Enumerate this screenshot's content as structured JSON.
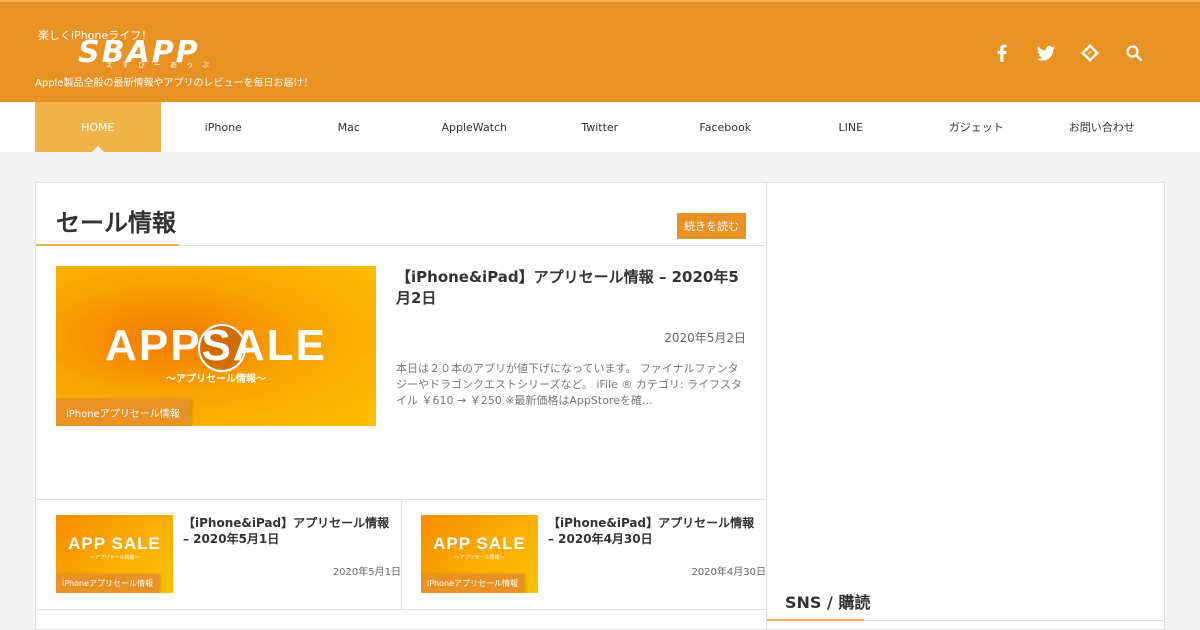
{
  "header": {
    "tagline_top": "楽しくiPhoneライフ！",
    "logo": "SBAPP",
    "logo_kana": "えすびーあっぷ",
    "tagline_bottom": "Apple製品全般の最新情報やアプリのレビューを毎日お届け！",
    "icons": [
      "facebook-icon",
      "twitter-icon",
      "feedly-icon",
      "search-icon"
    ]
  },
  "nav": {
    "items": [
      {
        "label": "HOME",
        "active": true
      },
      {
        "label": "iPhone"
      },
      {
        "label": "Mac"
      },
      {
        "label": "AppleWatch"
      },
      {
        "label": "Twitter"
      },
      {
        "label": "Facebook"
      },
      {
        "label": "LINE"
      },
      {
        "label": "ガジェット"
      },
      {
        "label": "お問い合わせ"
      }
    ]
  },
  "section": {
    "title": "セール情報",
    "more_label": "続きを読む"
  },
  "featured": {
    "thumb_main": "APPSALE",
    "thumb_sub": "〜アプリセール情報〜",
    "category": "iPhoneアプリセール情報",
    "title": "【iPhone&iPad】アプリセール情報 – 2020年5月2日",
    "date": "2020年5月2日",
    "excerpt": "本日は２０本のアプリが値下げになっています。 ファイナルファンタジーやドラゴンクエストシリーズなど。 iFile ® カテゴリ: ライフスタイル ￥610 → ￥250 ※最新価格はAppStoreを確..."
  },
  "cards": [
    {
      "thumb_main": "APP SALE",
      "thumb_sub": "〜アプリセール情報〜",
      "category": "iPhoneアプリセール情報",
      "title": "【iPhone&iPad】アプリセール情報 – 2020年5月1日",
      "date": "2020年5月1日"
    },
    {
      "thumb_main": "APP SALE",
      "thumb_sub": "〜アプリセール情報〜",
      "category": "iPhoneアプリセール情報",
      "title": "【iPhone&iPad】アプリセール情報 – 2020年4月30日",
      "date": "2020年4月30日"
    }
  ],
  "sidebar": {
    "title": "SNS / 購読"
  },
  "colors": {
    "header": "#e89224",
    "accent": "#f0b34a",
    "badge": "#e89224"
  }
}
